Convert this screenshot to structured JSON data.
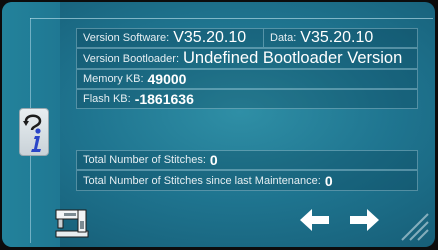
{
  "info": {
    "software_label": "Version Software:",
    "software_value": "V35.20.10",
    "data_label": "Data:",
    "data_value": "V35.20.10",
    "bootloader_label": "Version Bootloader:",
    "bootloader_value": "Undefined Bootloader Version",
    "memory_label": "Memory KB:",
    "memory_value": "49000",
    "flash_label": "Flash KB:",
    "flash_value": "-1861636"
  },
  "stitches": {
    "total_label": "Total Number of Stitches:",
    "total_value": "0",
    "maintenance_label": "Total Number of Stitches since last Maintenance:",
    "maintenance_value": "0"
  },
  "icons": {
    "info": "info-return-icon",
    "machine": "sewing-machine-icon",
    "back": "arrow-left-icon",
    "forward": "arrow-right-icon",
    "grip": "resize-grip-icon"
  },
  "colors": {
    "background": "#1f7590",
    "text": "#ffffff",
    "info_accent": "#2b46c8"
  }
}
